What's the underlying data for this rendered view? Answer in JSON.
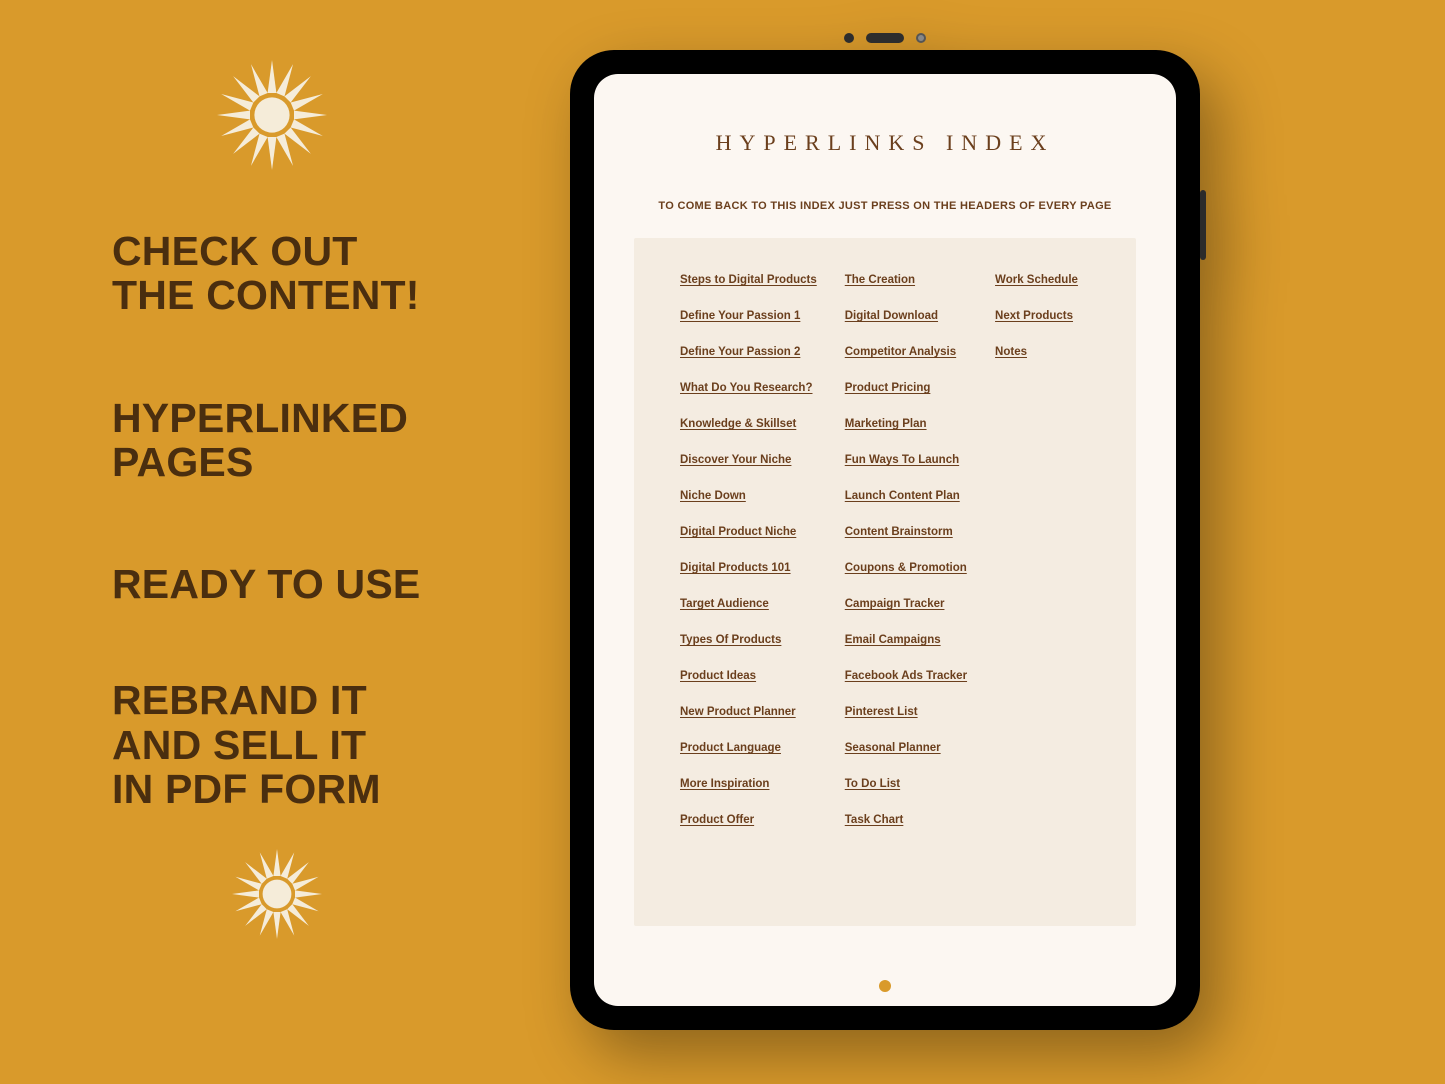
{
  "taglines": {
    "t1a": "CHECK OUT",
    "t1b": "THE CONTENT!",
    "t2a": "HYPERLINKED",
    "t2b": "PAGES",
    "t3": "READY TO USE",
    "t4a": "REBRAND IT",
    "t4b": "AND SELL IT",
    "t4c": "IN PDF FORM"
  },
  "doc": {
    "title": "HYPERLINKS INDEX",
    "subtitle": "TO COME BACK TO THIS INDEX JUST PRESS ON THE HEADERS OF EVERY PAGE"
  },
  "index": {
    "col1": [
      "Steps to Digital Products",
      "Define Your Passion 1",
      "Define Your Passion 2",
      "What Do You Research?",
      "Knowledge & Skillset",
      "Discover Your Niche",
      "Niche Down",
      "Digital Product Niche",
      "Digital Products 101",
      "Target Audience",
      "Types Of Products",
      "Product Ideas",
      "New Product Planner",
      "Product Language",
      "More Inspiration",
      "Product Offer"
    ],
    "col2": [
      "The Creation",
      "Digital Download",
      "Competitor Analysis",
      "Product Pricing",
      "Marketing Plan",
      "Fun Ways To Launch",
      "Launch Content Plan",
      "Content Brainstorm",
      "Coupons & Promotion",
      "Campaign Tracker",
      "Email Campaigns",
      "Facebook Ads Tracker",
      "Pinterest List",
      "Seasonal Planner",
      "To Do List",
      "Task Chart"
    ],
    "col3": [
      "Work Schedule",
      "Next Products",
      "Notes"
    ]
  }
}
